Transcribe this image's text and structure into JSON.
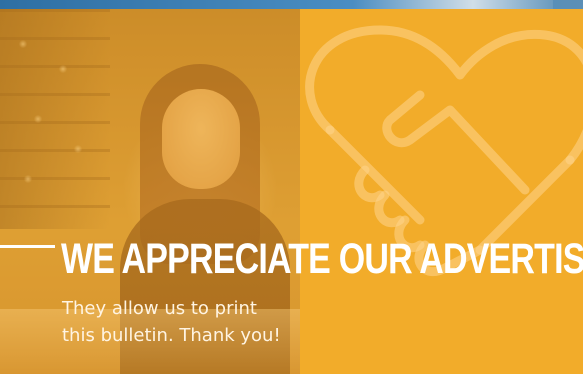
{
  "banner": {
    "headline": "WE APPRECIATE OUR ADVERTISERS!",
    "subtitle_line1": "They allow us to print",
    "subtitle_line2": "this bulletin. Thank you!"
  },
  "colors": {
    "panel_orange": "#F2AC2A",
    "text_white": "#FFFFFF",
    "top_strip_blue": "#4A8DC2"
  },
  "icons": {
    "watermark": "handshake-icon"
  }
}
